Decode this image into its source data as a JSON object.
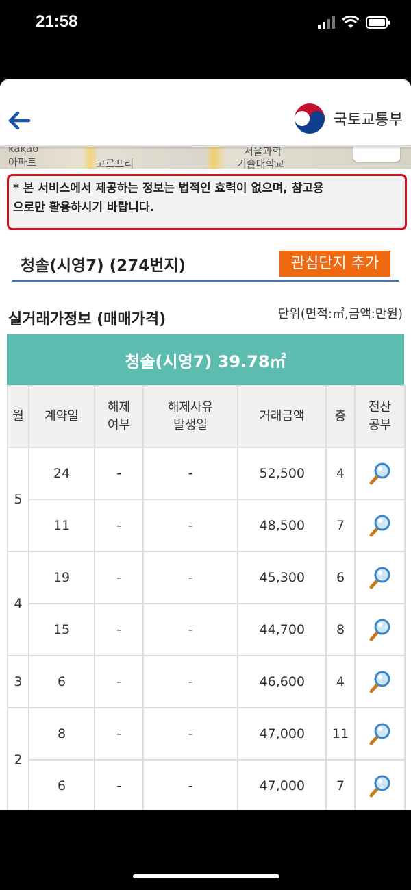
{
  "status": {
    "time": "21:58"
  },
  "header": {
    "org_name": "국토교통부",
    "back_icon": "back-arrow-icon",
    "accent": "#1a56a8"
  },
  "map": {
    "labels": [
      "kakao",
      "아파트",
      "고르프리",
      "서울과학",
      "기술대학교"
    ]
  },
  "notice": {
    "text": "* 본 서비스에서 제공하는 정보는 법적인 효력이 없으며, 참고용\n으로만 활용하시기 바랍니다.",
    "border_color": "#d0141e"
  },
  "apartment": {
    "title": "청솔(시영7) (274번지)",
    "add_favorite_label": "관심단지 추가",
    "button_color": "#f06a12"
  },
  "section": {
    "title": "실거래가정보 (매매가격)",
    "unit_note": "단위(면적:㎡,금액:만원)"
  },
  "type_header": {
    "label": "청솔(시영7) 39.78㎡",
    "color": "#5cbcb0"
  },
  "table": {
    "headers": [
      "월",
      "계약일",
      "해제\n여부",
      "해제사유\n발생일",
      "거래금액",
      "층",
      "전산\n공부"
    ],
    "groups": [
      {
        "month": "5",
        "rows": [
          {
            "day": "24",
            "cancel": "-",
            "cancel_date": "-",
            "price": "52,500",
            "floor": "4"
          },
          {
            "day": "11",
            "cancel": "-",
            "cancel_date": "-",
            "price": "48,500",
            "floor": "7"
          }
        ]
      },
      {
        "month": "4",
        "rows": [
          {
            "day": "19",
            "cancel": "-",
            "cancel_date": "-",
            "price": "45,300",
            "floor": "6"
          },
          {
            "day": "15",
            "cancel": "-",
            "cancel_date": "-",
            "price": "44,700",
            "floor": "8"
          }
        ]
      },
      {
        "month": "3",
        "rows": [
          {
            "day": "6",
            "cancel": "-",
            "cancel_date": "-",
            "price": "46,600",
            "floor": "4"
          }
        ]
      },
      {
        "month": "2",
        "rows": [
          {
            "day": "8",
            "cancel": "-",
            "cancel_date": "-",
            "price": "47,000",
            "floor": "11"
          },
          {
            "day": "6",
            "cancel": "-",
            "cancel_date": "-",
            "price": "47,000",
            "floor": "7"
          }
        ]
      }
    ],
    "detail_icon": "magnifier-icon"
  }
}
